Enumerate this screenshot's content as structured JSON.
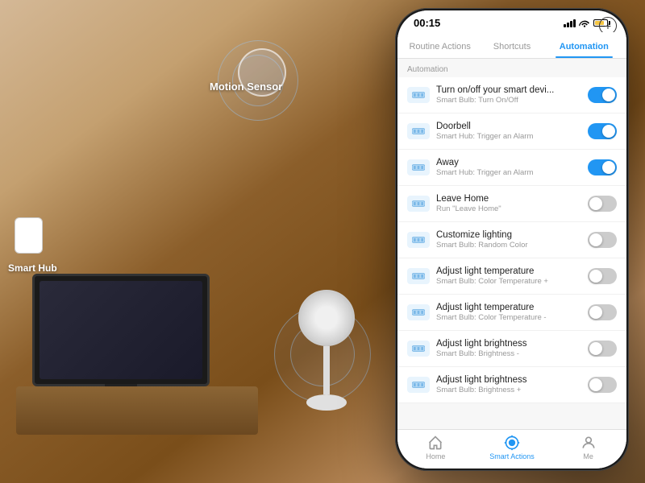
{
  "background": {
    "motionSensorLabel": "Motion Sensor",
    "smartHubLabel": "Smart Hub"
  },
  "phone": {
    "statusBar": {
      "time": "00:15",
      "signal": "●●●",
      "wifi": "wifi",
      "battery": "70%"
    },
    "addButton": "+",
    "navTabs": [
      {
        "id": "routine",
        "label": "Routine Actions",
        "active": false
      },
      {
        "id": "shortcuts",
        "label": "Shortcuts",
        "active": false
      },
      {
        "id": "automation",
        "label": "Automation",
        "active": true
      }
    ],
    "sectionLabel": "Automation",
    "automationItems": [
      {
        "id": 1,
        "title": "Turn on/off your smart devi...",
        "subtitle": "Smart Bulb: Turn On/Off",
        "toggleOn": true
      },
      {
        "id": 2,
        "title": "Doorbell",
        "subtitle": "Smart Hub: Trigger an Alarm",
        "toggleOn": true
      },
      {
        "id": 3,
        "title": "Away",
        "subtitle": "Smart Hub: Trigger an Alarm",
        "toggleOn": true
      },
      {
        "id": 4,
        "title": "Leave Home",
        "subtitle": "Run \"Leave Home\"",
        "toggleOn": false
      },
      {
        "id": 5,
        "title": "Customize lighting",
        "subtitle": "Smart Bulb: Random Color",
        "toggleOn": false
      },
      {
        "id": 6,
        "title": "Adjust light temperature",
        "subtitle": "Smart Bulb: Color Temperature +",
        "toggleOn": false
      },
      {
        "id": 7,
        "title": "Adjust light temperature",
        "subtitle": "Smart Bulb: Color Temperature -",
        "toggleOn": false
      },
      {
        "id": 8,
        "title": "Adjust light brightness",
        "subtitle": "Smart Bulb: Brightness -",
        "toggleOn": false
      },
      {
        "id": 9,
        "title": "Adjust light brightness",
        "subtitle": "Smart Bulb: Brightness +",
        "toggleOn": false
      }
    ],
    "bottomNav": [
      {
        "id": "home",
        "label": "Home",
        "active": false
      },
      {
        "id": "smart-actions",
        "label": "Smart Actions",
        "active": true
      },
      {
        "id": "me",
        "label": "Me",
        "active": false
      }
    ]
  }
}
